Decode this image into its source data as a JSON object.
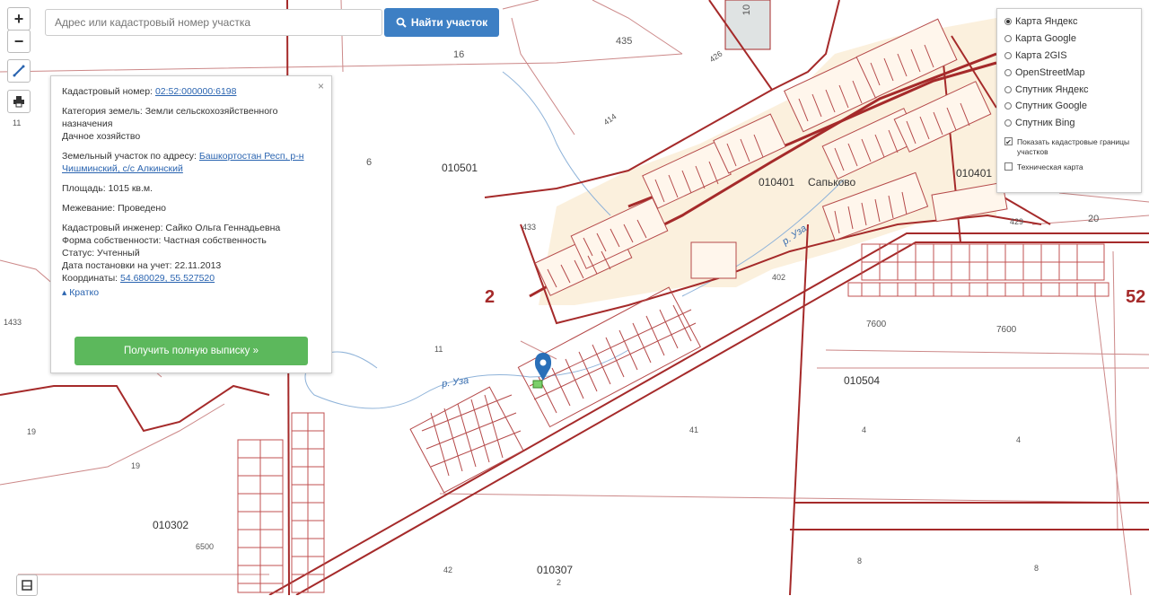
{
  "search": {
    "placeholder": "Адрес или кадастровый номер участка",
    "button_label": "Найти участок"
  },
  "controls": {
    "zoom_in": "+",
    "zoom_out": "−"
  },
  "popup": {
    "cadastral_label": "Кадастровый номер:",
    "cadastral_value": "02:52:000000:6198",
    "category_label": "Категория земель:",
    "category_value": "Земли сельскохозяйственного назначения",
    "category_value2": "Дачное хозяйство",
    "address_label": "Земельный участок по адресу:",
    "address_value": "Башкортостан Респ, р-н Чишминский, с/с Алкинский",
    "area_label": "Площадь:",
    "area_value": "1015 кв.м.",
    "market_label": "Межевание:",
    "market_value": "Проведено",
    "engineer_label": "Кадастровый инженер:",
    "engineer_value": "Сайко Ольга Геннадьевна",
    "ownership_label": "Форма собственности:",
    "ownership_value": "Частная собственность",
    "status_label": "Статус:",
    "status_value": "Учтенный",
    "date_label": "Дата постановки на учет:",
    "date_value": "22.11.2013",
    "coords_label": "Координаты:",
    "coords_value": "54.680029, 55.527520",
    "collapse_label": "▴ Кратко",
    "button_label": "Получить полную выписку »",
    "close": "×"
  },
  "layers": {
    "options": [
      "Карта Яндекс",
      "Карта Google",
      "Карта 2GIS",
      "OpenStreetMap",
      "Спутник Яндекс",
      "Спутник Google",
      "Спутник Bing"
    ],
    "selected_index": 0,
    "checkbox1": "Показать кадастровые границы участков",
    "checkbox1_checked": true,
    "checkbox2": "Техническая карта",
    "checkbox2_checked": false
  },
  "map_labels": {
    "q435": "435",
    "q16": "16",
    "q10": "10",
    "q426": "426",
    "q414": "414",
    "q11a": "11",
    "q6": "6",
    "q010501": "010501",
    "q433": "433",
    "q010401": "010401",
    "village": "Сапьково",
    "q010402": "010401",
    "q429": "429",
    "q20": "20",
    "q52": "52",
    "q2": "2",
    "q1433": "1433",
    "q7600a": "7600",
    "q7600b": "7600",
    "q402": "402",
    "river1": "р. Уза",
    "river2": "р. Уза",
    "q11b": "11",
    "q010504": "010504",
    "q41": "41",
    "q4a": "4",
    "q4b": "4",
    "q19a": "19",
    "q19b": "19",
    "q010302": "010302",
    "q6500": "6500",
    "q42": "42",
    "q010307": "010307",
    "q2b": "2",
    "q8a": "8",
    "q8b": "8"
  }
}
